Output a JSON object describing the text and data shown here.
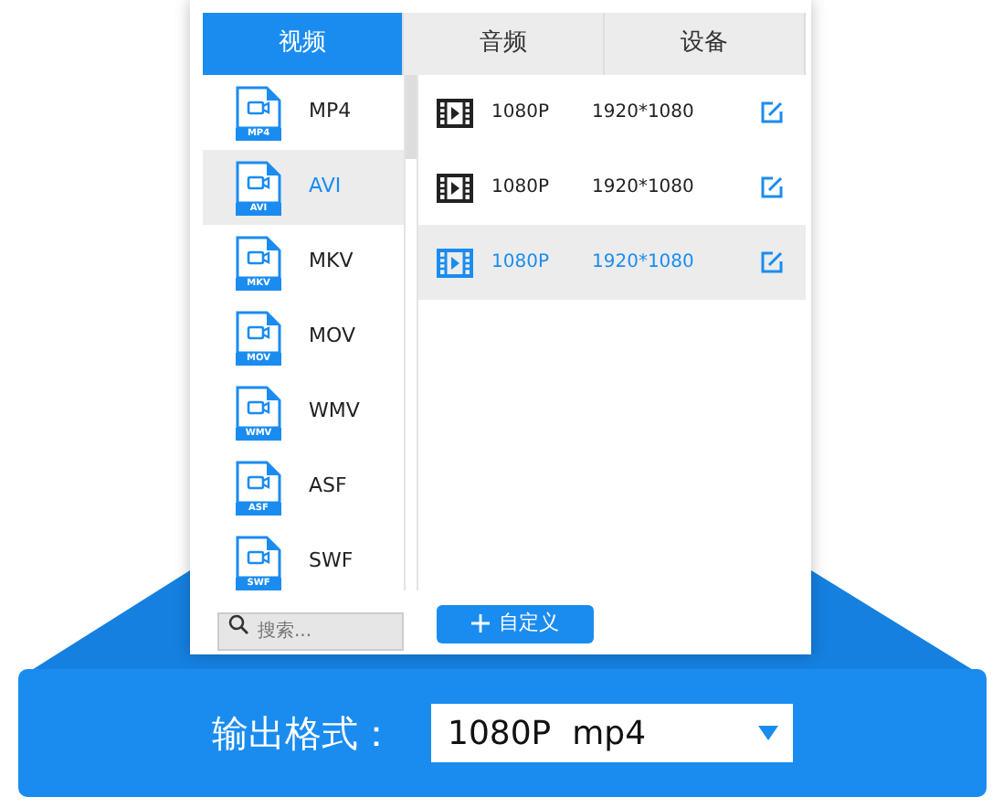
{
  "tabs": [
    {
      "label": "视频",
      "selected": true
    },
    {
      "label": "音频",
      "selected": false
    },
    {
      "label": "设备",
      "selected": false
    }
  ],
  "formats": [
    {
      "name": "MP4",
      "tag": "MP4",
      "selected": false
    },
    {
      "name": "AVI",
      "tag": "AVI",
      "selected": true
    },
    {
      "name": "MKV",
      "tag": "MKV",
      "selected": false
    },
    {
      "name": "MOV",
      "tag": "MOV",
      "selected": false
    },
    {
      "name": "WMV",
      "tag": "WMV",
      "selected": false
    },
    {
      "name": "ASF",
      "tag": "ASF",
      "selected": false
    },
    {
      "name": "SWF",
      "tag": "SWF",
      "selected": false
    }
  ],
  "presets": [
    {
      "quality": "1080P",
      "size": "1920*1080",
      "selected": false
    },
    {
      "quality": "1080P",
      "size": "1920*1080",
      "selected": false
    },
    {
      "quality": "1080P",
      "size": "1920*1080",
      "selected": true
    }
  ],
  "search": {
    "placeholder": "搜索..."
  },
  "custom_button": {
    "label": "自定义"
  },
  "output": {
    "label": "输出格式：",
    "value": "1080P  mp4"
  }
}
